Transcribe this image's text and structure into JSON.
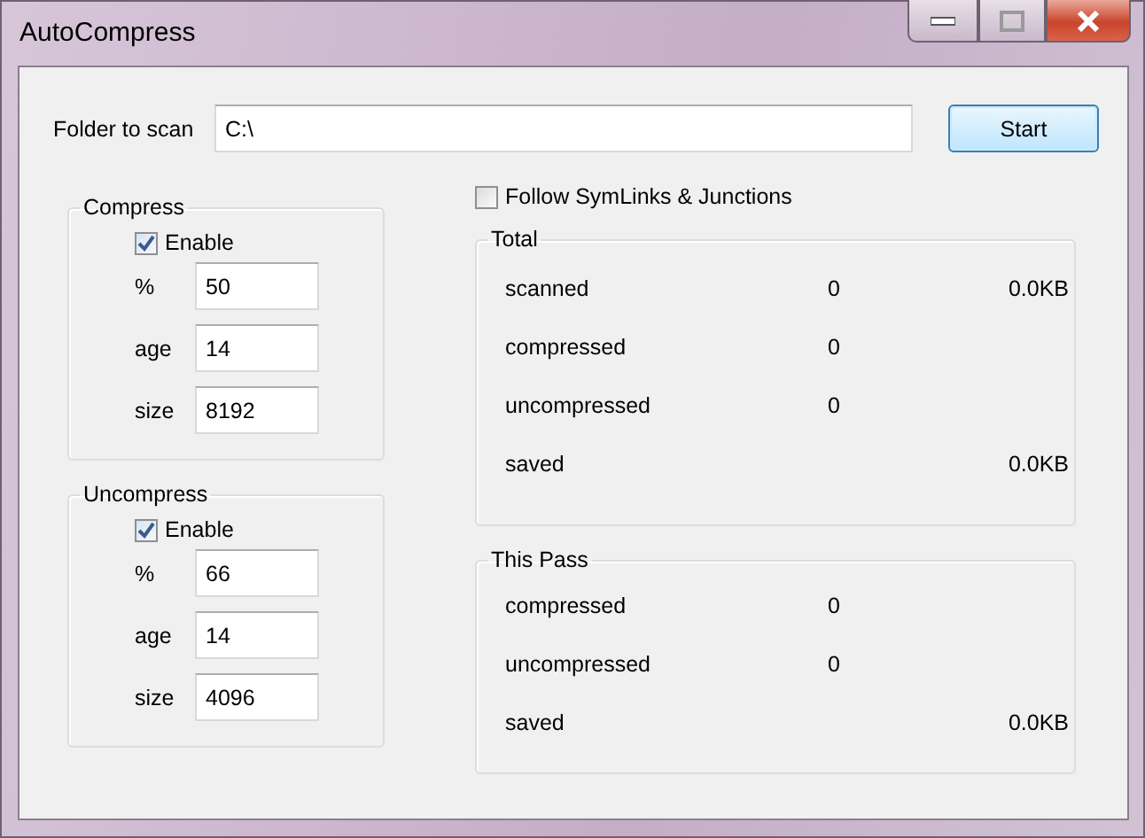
{
  "window": {
    "title": "AutoCompress"
  },
  "folder": {
    "label": "Folder to scan",
    "value": "C:\\"
  },
  "start_button": {
    "label": "Start"
  },
  "groups": [
    {
      "title": "Compress",
      "enable": {
        "label": "Enable",
        "checked": true
      },
      "fields": [
        {
          "label": "%",
          "value": "50"
        },
        {
          "label": "age",
          "value": "14"
        },
        {
          "label": "size",
          "value": "8192"
        }
      ]
    },
    {
      "title": "Uncompress",
      "enable": {
        "label": "Enable",
        "checked": true
      },
      "fields": [
        {
          "label": "%",
          "value": "66"
        },
        {
          "label": "age",
          "value": "14"
        },
        {
          "label": "size",
          "value": "4096"
        }
      ]
    }
  ],
  "follow_symlinks": {
    "label": "Follow SymLinks & Junctions",
    "checked": false
  },
  "stats": [
    {
      "title": "Total",
      "rows": [
        {
          "label": "scanned",
          "count": "0",
          "size": "0.0KB"
        },
        {
          "label": "compressed",
          "count": "0"
        },
        {
          "label": "uncompressed",
          "count": "0"
        },
        {
          "label": "saved",
          "size": "0.0KB"
        }
      ]
    },
    {
      "title": "This Pass",
      "rows": [
        {
          "label": "compressed",
          "count": "0"
        },
        {
          "label": "uncompressed",
          "count": "0"
        },
        {
          "label": "saved",
          "size": "0.0KB"
        }
      ]
    }
  ]
}
